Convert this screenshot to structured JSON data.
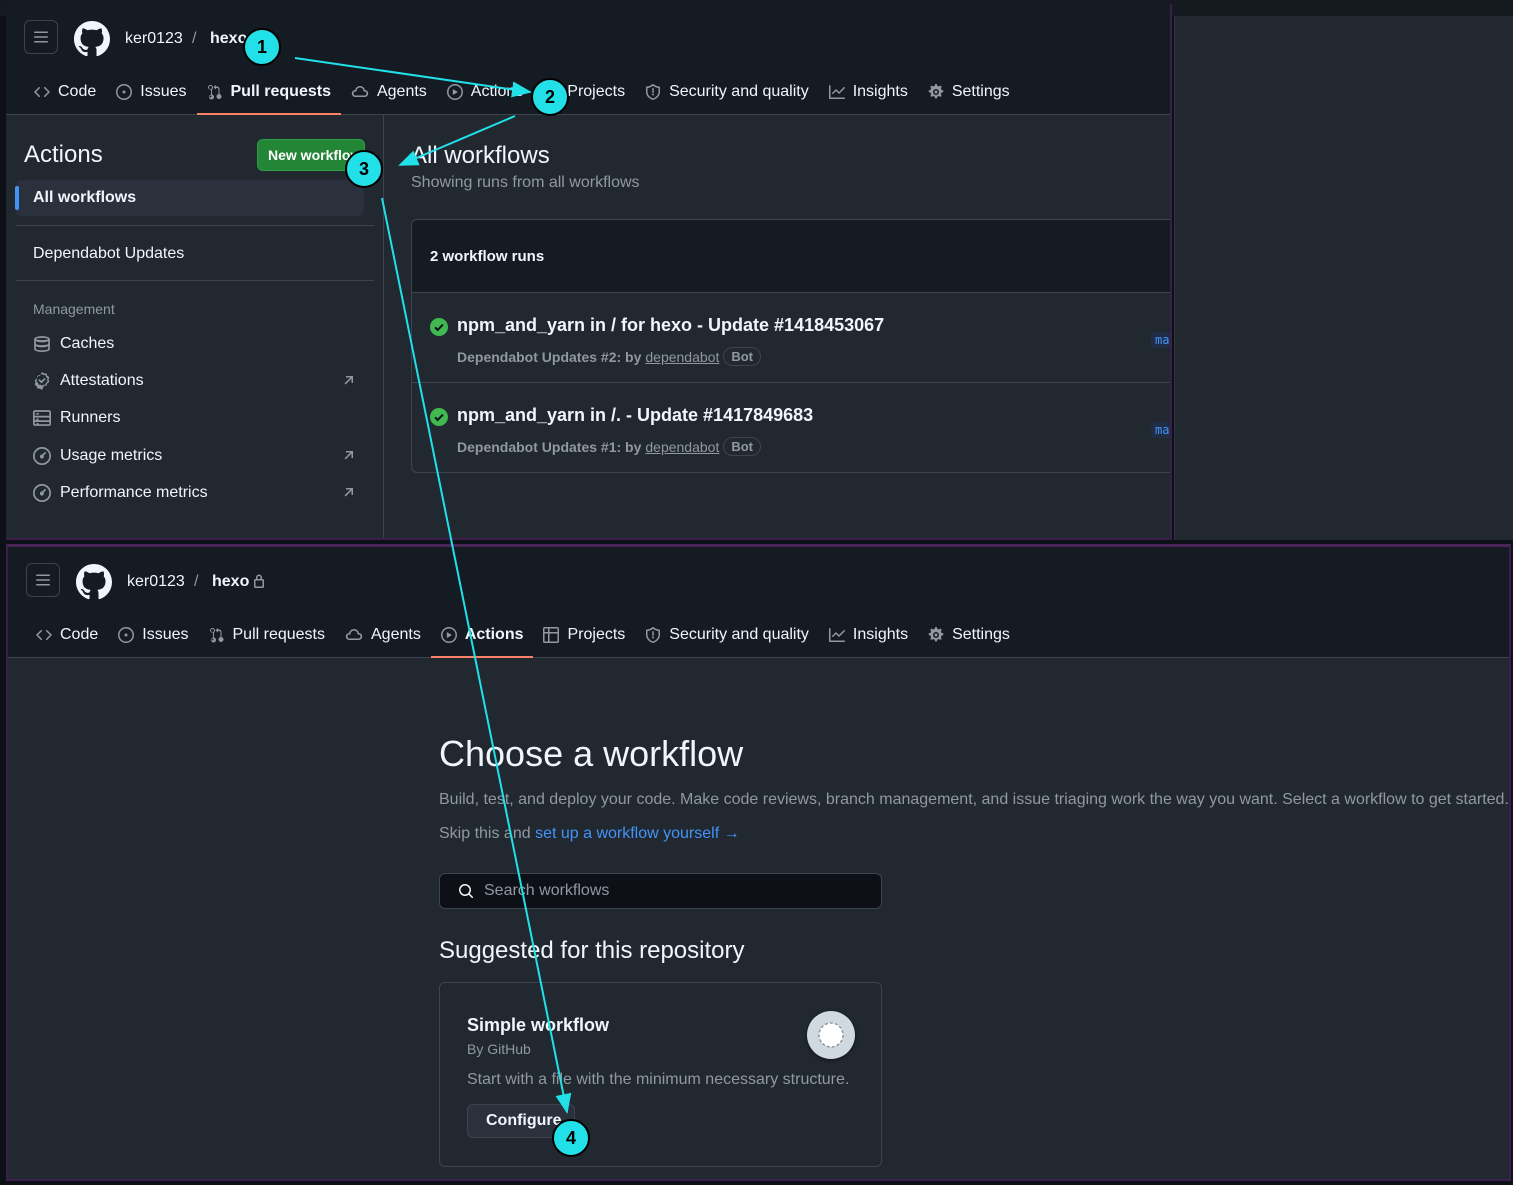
{
  "header": {
    "owner": "ker0123",
    "separator": "/",
    "repo_top": "hexo",
    "repo_bottom": "hexo"
  },
  "nav": {
    "tabs": [
      {
        "label": "Code",
        "icon": "code-icon"
      },
      {
        "label": "Issues",
        "icon": "issue-opened-icon"
      },
      {
        "label": "Pull requests",
        "icon": "git-pull-request-icon"
      },
      {
        "label": "Agents",
        "icon": "agent-icon"
      },
      {
        "label": "Actions",
        "icon": "play-icon"
      },
      {
        "label": "Projects",
        "icon": "table-icon"
      },
      {
        "label": "Security and quality",
        "icon": "shield-icon"
      },
      {
        "label": "Insights",
        "icon": "graph-icon"
      },
      {
        "label": "Settings",
        "icon": "gear-icon"
      }
    ],
    "top_selected": "Pull requests",
    "bottom_selected": "Actions"
  },
  "sidebar": {
    "title": "Actions",
    "new_workflow_label": "New workflow",
    "all_workflows": "All workflows",
    "dependabot": "Dependabot Updates",
    "management_heading": "Management",
    "management": [
      {
        "label": "Caches",
        "icon": "database-icon",
        "external": false
      },
      {
        "label": "Attestations",
        "icon": "verified-icon",
        "external": true
      },
      {
        "label": "Runners",
        "icon": "server-icon",
        "external": false
      },
      {
        "label": "Usage metrics",
        "icon": "meter-icon",
        "external": true
      },
      {
        "label": "Performance metrics",
        "icon": "meter-icon",
        "external": true
      }
    ]
  },
  "main": {
    "title": "All workflows",
    "subtitle": "Showing runs from all workflows",
    "runs_count": "2 workflow runs",
    "runs": [
      {
        "title": "npm_and_yarn in / for hexo - Update #1418453067",
        "meta": "Dependabot Updates #2: by",
        "actor": "dependabot",
        "badge": "Bot",
        "branch": "ma"
      },
      {
        "title": "npm_and_yarn in /. - Update #1417849683",
        "meta": "Dependabot Updates #1: by",
        "actor": "dependabot",
        "badge": "Bot",
        "branch": "ma"
      }
    ]
  },
  "choose": {
    "title": "Choose a workflow",
    "description": "Build, test, and deploy your code. Make code reviews, branch management, and issue triaging work the way you want. Select a workflow to get started.",
    "skip_prefix": "Skip this and ",
    "skip_link": "set up a workflow yourself",
    "skip_arrow": "→",
    "search_placeholder": "Search workflows",
    "suggested_heading": "Suggested for this repository",
    "card": {
      "title": "Simple workflow",
      "by": "By GitHub",
      "description": "Start with a file with the minimum necessary structure.",
      "button": "Configure"
    }
  },
  "annotations": {
    "color": "#22e0e8",
    "markers": [
      "1",
      "2",
      "3",
      "4"
    ]
  }
}
